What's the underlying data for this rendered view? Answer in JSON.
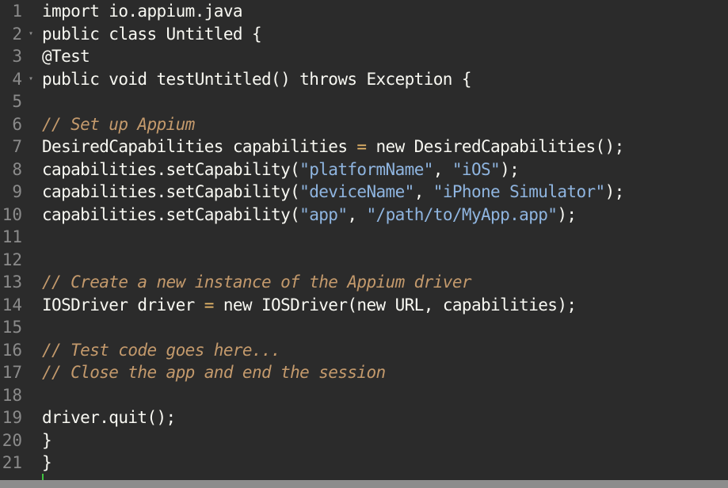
{
  "colors": {
    "background": "#2b2b2b",
    "text": "#f8f8f2",
    "comment": "#c49a6c",
    "string": "#8fb5e0",
    "operator": "#e8b86a",
    "gutter": "#8b8b8b",
    "cursor": "#3fc23f",
    "statusbar": "#8c8c8c"
  },
  "lines": [
    {
      "n": "1",
      "fold": false,
      "tokens": [
        {
          "t": "import io.appium.java"
        }
      ]
    },
    {
      "n": "2",
      "fold": true,
      "tokens": [
        {
          "t": "public class Untitled {"
        }
      ]
    },
    {
      "n": "3",
      "fold": false,
      "tokens": [
        {
          "t": "@Test"
        }
      ]
    },
    {
      "n": "4",
      "fold": true,
      "tokens": [
        {
          "t": "public void testUntitled() throws Exception {"
        }
      ]
    },
    {
      "n": "5",
      "fold": false,
      "tokens": []
    },
    {
      "n": "6",
      "fold": false,
      "tokens": [
        {
          "t": "// Set up Appium",
          "c": "comment"
        }
      ]
    },
    {
      "n": "7",
      "fold": false,
      "tokens": [
        {
          "t": "DesiredCapabilities capabilities "
        },
        {
          "t": "=",
          "c": "op"
        },
        {
          "t": " new DesiredCapabilities();"
        }
      ]
    },
    {
      "n": "8",
      "fold": false,
      "tokens": [
        {
          "t": "capabilities.setCapability("
        },
        {
          "t": "\"platformName\"",
          "c": "string"
        },
        {
          "t": ", "
        },
        {
          "t": "\"iOS\"",
          "c": "string"
        },
        {
          "t": ");"
        }
      ]
    },
    {
      "n": "9",
      "fold": false,
      "tokens": [
        {
          "t": "capabilities.setCapability("
        },
        {
          "t": "\"deviceName\"",
          "c": "string"
        },
        {
          "t": ", "
        },
        {
          "t": "\"iPhone Simulator\"",
          "c": "string"
        },
        {
          "t": ");"
        }
      ]
    },
    {
      "n": "10",
      "fold": false,
      "tokens": [
        {
          "t": "capabilities.setCapability("
        },
        {
          "t": "\"app\"",
          "c": "string"
        },
        {
          "t": ", "
        },
        {
          "t": "\"/path/to/MyApp.app\"",
          "c": "string"
        },
        {
          "t": ");"
        }
      ]
    },
    {
      "n": "11",
      "fold": false,
      "tokens": []
    },
    {
      "n": "12",
      "fold": false,
      "tokens": []
    },
    {
      "n": "13",
      "fold": false,
      "tokens": [
        {
          "t": "// Create a new instance of the Appium driver",
          "c": "comment"
        }
      ]
    },
    {
      "n": "14",
      "fold": false,
      "tokens": [
        {
          "t": "IOSDriver driver "
        },
        {
          "t": "=",
          "c": "op"
        },
        {
          "t": " new IOSDriver(new URL, capabilities);"
        }
      ]
    },
    {
      "n": "15",
      "fold": false,
      "tokens": []
    },
    {
      "n": "16",
      "fold": false,
      "tokens": [
        {
          "t": "// Test code goes here...",
          "c": "comment"
        }
      ]
    },
    {
      "n": "17",
      "fold": false,
      "tokens": [
        {
          "t": "// Close the app and end the session",
          "c": "comment"
        }
      ]
    },
    {
      "n": "18",
      "fold": false,
      "tokens": []
    },
    {
      "n": "19",
      "fold": false,
      "tokens": [
        {
          "t": "driver.quit();"
        }
      ]
    },
    {
      "n": "20",
      "fold": false,
      "tokens": [
        {
          "t": "}"
        }
      ]
    },
    {
      "n": "21",
      "fold": false,
      "tokens": [
        {
          "t": "}"
        }
      ]
    }
  ]
}
